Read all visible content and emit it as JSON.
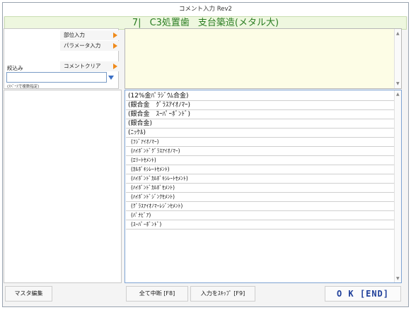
{
  "window": {
    "title": "コメント入力 Rev2"
  },
  "header": {
    "tooth": "7|",
    "title": "C3処置歯",
    "subtitle": "支台築造(メタル大)"
  },
  "left_panel": {
    "buttons": [
      {
        "label": "部位入力"
      },
      {
        "label": "パラメータ入力"
      },
      {
        "label": "コメントクリア"
      }
    ],
    "filter_label": "絞込み",
    "filter_value": "",
    "filter_hint": "(ｽﾍﾟｰｽで複数指定)"
  },
  "comment_list": {
    "items": [
      "(12%金ﾊﾟﾗｼﾞｳﾑ合金)",
      "(銀合金　ｸﾞﾗｽｱｲｵﾉﾏｰ)",
      "(銀合金　ｽｰﾊﾟｰﾎﾞﾝﾄﾞ)",
      "(銀合金)",
      "(ﾆｯｹﾙ)",
      "(ﾌｼﾞｱｲｵﾉﾏｰ)",
      "(ﾊｲﾎﾞﾝﾄﾞｸﾞﾗｽｱｲｵﾉﾏｰ)",
      "(ｴﾘｰﾄｾﾒﾝﾄ)",
      "(ｶﾙﾎﾞｷｼﾚｰﾄｾﾒﾝﾄ)",
      "(ﾊｲﾎﾞﾝﾄﾞｶﾙﾎﾞｷｼﾚｰﾄｾﾒﾝﾄ)",
      "(ﾊｲﾎﾞﾝﾄﾞｶﾙﾎﾞｾﾒﾝﾄ)",
      "(ﾊｲﾎﾞﾝﾄﾞｼﾞﾝｸｾﾒﾝﾄ)",
      "(ｸﾞﾗｽｱｲｵﾉﾏｰﾚｼﾞﾝｾﾒﾝﾄ)",
      "(ﾊﾟﾅﾋﾞｱ)",
      "(ｽｰﾊﾟｰﾎﾞﾝﾄﾞ)"
    ]
  },
  "footer": {
    "master_edit": "マスタ編集",
    "abort_all": "全て中断 [F8]",
    "skip_input": "入力をｽｷｯﾌﾟ [F9]",
    "ok": "O K [END]"
  },
  "colors": {
    "header_text": "#2a7d22",
    "header_bg": "#eef7df",
    "memo_bg": "#fdfde6",
    "arrow": "#ef8a1a",
    "ok_text": "#1f3f9a"
  }
}
